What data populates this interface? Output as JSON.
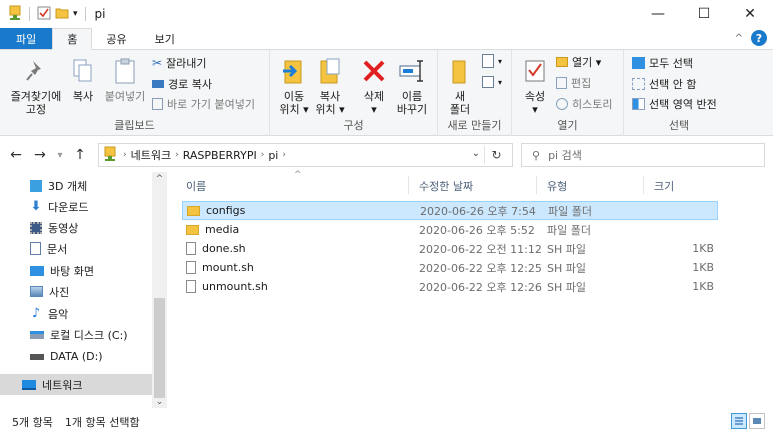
{
  "window": {
    "title": "pi",
    "controls": {
      "minimize": "—",
      "maximize": "☐",
      "close": "✕"
    }
  },
  "ribbon_tabs": {
    "file": "파일",
    "home": "홈",
    "share": "공유",
    "view": "보기"
  },
  "ribbon": {
    "clipboard": {
      "pin_label_1": "즐겨찾기에",
      "pin_label_2": "고정",
      "copy": "복사",
      "paste": "붙여넣기",
      "cut": "잘라내기",
      "copy_path": "경로 복사",
      "paste_shortcut": "바로 가기 붙여넣기",
      "label": "클립보드"
    },
    "organize": {
      "move_to_1": "이동",
      "move_to_2": "위치 ▾",
      "copy_to_1": "복사",
      "copy_to_2": "위치 ▾",
      "delete_1": "삭제",
      "delete_2": "▾",
      "rename_1": "이름",
      "rename_2": "바꾸기",
      "label": "구성"
    },
    "new": {
      "new_folder_1": "새",
      "new_folder_2": "폴더",
      "label": "새로 만들기"
    },
    "open": {
      "properties_1": "속성",
      "properties_2": "▾",
      "open": "열기 ▾",
      "edit": "편집",
      "history": "히스토리",
      "label": "열기"
    },
    "select": {
      "select_all": "모두 선택",
      "select_none": "선택 안 함",
      "invert": "선택 영역 반전",
      "label": "선택"
    }
  },
  "address": {
    "crumbs": [
      "네트워크",
      "RASPBERRYPI",
      "pi"
    ],
    "search_placeholder": "pi 검색"
  },
  "nav_pane": {
    "items": [
      {
        "label": "3D 개체",
        "icon": "cube-3d-icon",
        "color": "#3aa0e0"
      },
      {
        "label": "다운로드",
        "icon": "download-arrow-icon",
        "color": "#2f7fd1"
      },
      {
        "label": "동영상",
        "icon": "film-icon",
        "color": "#3b5a85"
      },
      {
        "label": "문서",
        "icon": "document-icon",
        "color": "#5f7fa8"
      },
      {
        "label": "바탕 화면",
        "icon": "desktop-icon",
        "color": "#2f8fe0"
      },
      {
        "label": "사진",
        "icon": "picture-icon",
        "color": "#5b88b6"
      },
      {
        "label": "음악",
        "icon": "music-note-icon",
        "color": "#1f7ad6"
      },
      {
        "label": "로컬 디스크 (C:)",
        "icon": "drive-windows-icon",
        "color": "#4a6a8a"
      },
      {
        "label": "DATA (D:)",
        "icon": "drive-icon",
        "color": "#555555"
      },
      {
        "label": "네트워크",
        "icon": "network-icon",
        "color": "#1f8ae0"
      }
    ],
    "selected_index": 9
  },
  "file_list": {
    "columns": {
      "name": "이름",
      "date": "수정한 날짜",
      "type": "유형",
      "size": "크기"
    },
    "rows": [
      {
        "name": "configs",
        "date": "2020-06-26 오후 7:54",
        "type": "파일 폴더",
        "size": "",
        "kind": "folder",
        "selected": true
      },
      {
        "name": "media",
        "date": "2020-06-26 오후 5:52",
        "type": "파일 폴더",
        "size": "",
        "kind": "folder",
        "selected": false
      },
      {
        "name": "done.sh",
        "date": "2020-06-22 오전 11:12",
        "type": "SH 파일",
        "size": "1KB",
        "kind": "file",
        "selected": false
      },
      {
        "name": "mount.sh",
        "date": "2020-06-22 오후 12:25",
        "type": "SH 파일",
        "size": "1KB",
        "kind": "file",
        "selected": false
      },
      {
        "name": "unmount.sh",
        "date": "2020-06-22 오후 12:26",
        "type": "SH 파일",
        "size": "1KB",
        "kind": "file",
        "selected": false
      }
    ]
  },
  "status": {
    "item_count": "5개 항목",
    "selected": "1개 항목 선택함"
  },
  "colors": {
    "accent": "#1979ca",
    "selection": "#cce8ff",
    "folder": "#f4c441"
  }
}
